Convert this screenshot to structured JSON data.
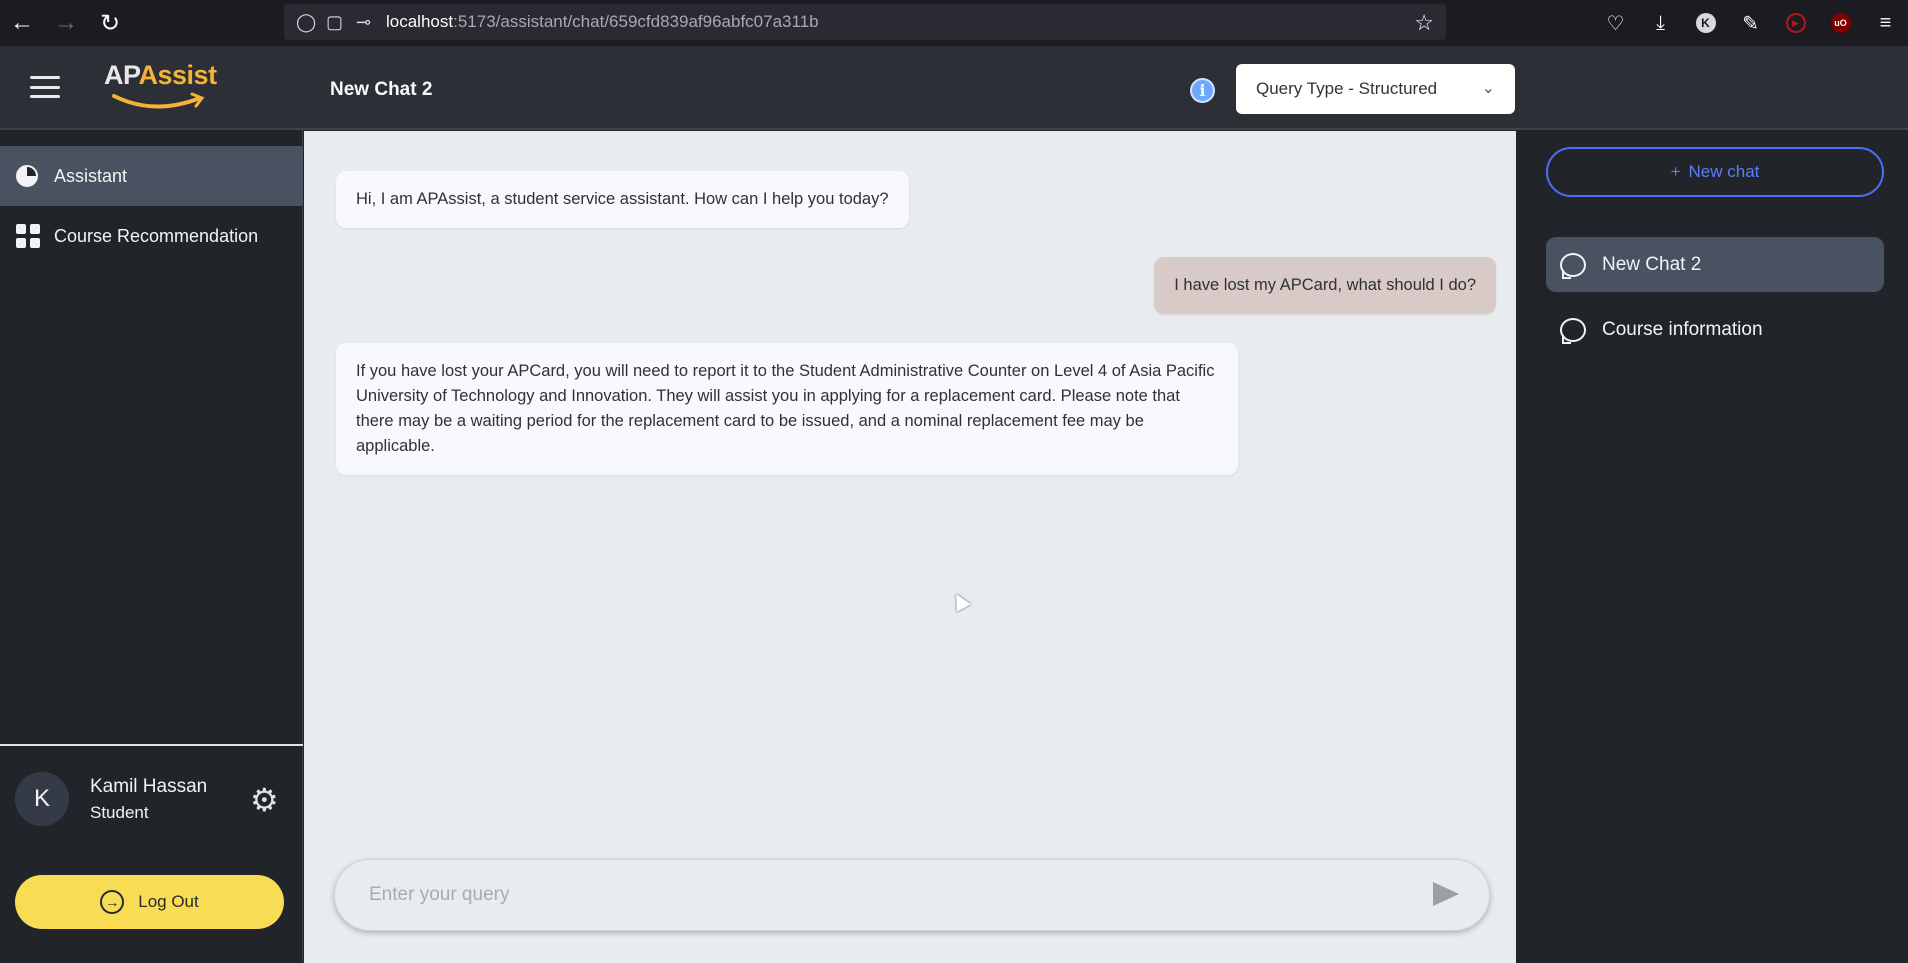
{
  "browser": {
    "url_host": "localhost",
    "url_path": ":5173/assistant/chat/659cfd839af96abfc07a311b",
    "badge_k": "K",
    "badge_ub": "uO"
  },
  "header": {
    "logo_ap": "AP",
    "logo_assist": "Assist",
    "chat_title": "New Chat 2",
    "info_glyph": "i",
    "query_type": "Query Type - Structured"
  },
  "sidebar": {
    "items": [
      {
        "label": "Assistant",
        "icon": "pie-chart-icon",
        "active": true
      },
      {
        "label": "Course Recommendation",
        "icon": "grid-icon",
        "active": false
      }
    ],
    "user": {
      "initial": "K",
      "name": "Kamil Hassan",
      "role": "Student"
    },
    "logout_label": "Log Out"
  },
  "chat": {
    "messages": [
      {
        "role": "bot",
        "text": "Hi, I am APAssist, a student service assistant. How can I help you today?"
      },
      {
        "role": "user",
        "text": "I have lost my APCard, what should I do?"
      },
      {
        "role": "bot",
        "text": "If you have lost your APCard, you will need to report it to the Student Administrative Counter on Level 4 of Asia Pacific University of Technology and Innovation. They will assist you in applying for a replacement card. Please note that there may be a waiting period for the replacement card to be issued, and a nominal replacement fee may be applicable."
      }
    ],
    "input_placeholder": "Enter your query"
  },
  "right_panel": {
    "new_chat_label": "New chat",
    "new_chat_plus": "+",
    "chats": [
      {
        "label": "New Chat 2",
        "active": true
      },
      {
        "label": "Course information",
        "active": false
      }
    ]
  },
  "colors": {
    "accent_yellow": "#f7dc54",
    "accent_blue": "#4c6ef5",
    "active_item": "#495261",
    "user_bubble": "#d8cbc7",
    "bot_bubble": "#f8f9fc"
  }
}
